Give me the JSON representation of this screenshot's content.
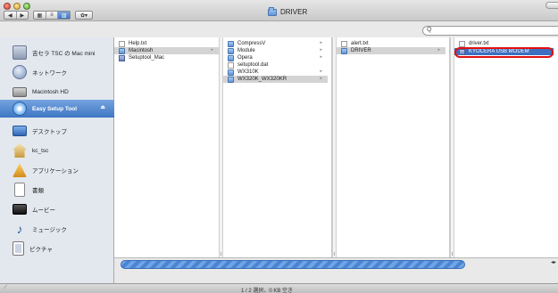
{
  "window": {
    "title": "DRIVER"
  },
  "toolbar": {
    "back_icon": "back-arrow-icon",
    "forward_icon": "forward-arrow-icon",
    "view_icons": [
      "icon-view-icon",
      "list-view-icon",
      "column-view-icon"
    ],
    "action_label": "✿▾",
    "search_placeholder": "Q"
  },
  "sidebar": {
    "items": [
      {
        "label": "吉セラ TSC の Mac mini",
        "icon": "computer-icon"
      },
      {
        "label": "ネットワーク",
        "icon": "network-globe-icon"
      },
      {
        "label": "Macintosh HD",
        "icon": "hard-disk-icon"
      },
      {
        "label": "Easy Setup Tool",
        "icon": "cd-disk-icon",
        "selected": true
      },
      {
        "label": "デスクトップ",
        "icon": "desktop-icon"
      },
      {
        "label": "kc_tsc",
        "icon": "home-icon"
      },
      {
        "label": "アプリケーション",
        "icon": "applications-icon"
      },
      {
        "label": "書類",
        "icon": "documents-icon"
      },
      {
        "label": "ムービー",
        "icon": "movies-icon"
      },
      {
        "label": "ミュージック",
        "icon": "music-icon"
      },
      {
        "label": "ピクチャ",
        "icon": "pictures-icon"
      }
    ]
  },
  "columns": [
    {
      "items": [
        {
          "name": "Help.txt",
          "kind": "doc"
        },
        {
          "name": "Macintosh",
          "kind": "folder",
          "highlight": true,
          "arrow": true
        },
        {
          "name": "Setuptool_Mac",
          "kind": "app"
        }
      ]
    },
    {
      "items": [
        {
          "name": "CompressV",
          "kind": "folder",
          "arrow": true
        },
        {
          "name": "Module",
          "kind": "folder",
          "arrow": true
        },
        {
          "name": "Opera",
          "kind": "folder",
          "arrow": true
        },
        {
          "name": "setuptool.dat",
          "kind": "doc"
        },
        {
          "name": "WX310K",
          "kind": "folder",
          "arrow": true
        },
        {
          "name": "WX320K_WX320KR",
          "kind": "folder",
          "highlight": true,
          "arrow": true
        }
      ]
    },
    {
      "items": [
        {
          "name": "alert.txt",
          "kind": "doc"
        },
        {
          "name": "DRIVER",
          "kind": "folder",
          "highlight": true,
          "arrow": true
        }
      ]
    },
    {
      "items": [
        {
          "name": "driver.txt",
          "kind": "doc"
        },
        {
          "name": "KYOCERA USB MODEM",
          "kind": "app",
          "selected": true
        }
      ]
    }
  ],
  "status": {
    "text": "1 / 2 選択、0 KB 空き"
  },
  "colors": {
    "selection": "#3d6fc2",
    "highlight": "#d4d4d4",
    "annotation": "#e01010"
  }
}
